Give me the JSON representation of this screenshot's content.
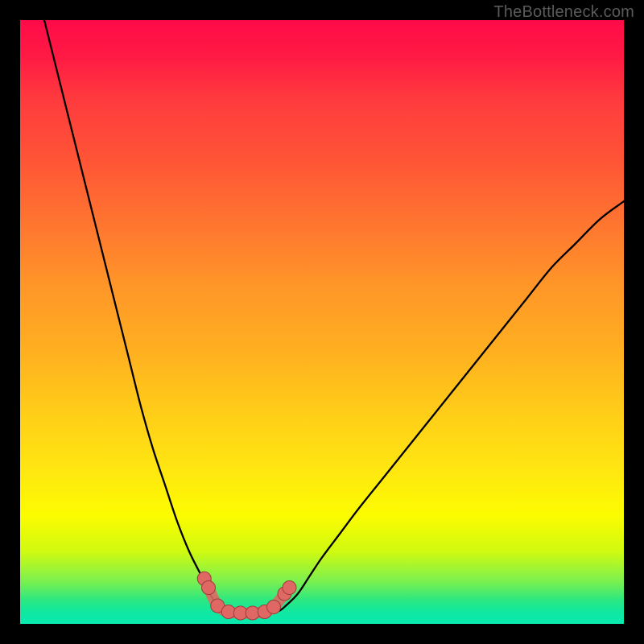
{
  "watermark": "TheBottleneck.com",
  "chart_data": {
    "type": "line",
    "title": "",
    "xlabel": "",
    "ylabel": "",
    "xlim": [
      0,
      100
    ],
    "ylim": [
      0,
      100
    ],
    "series": [
      {
        "name": "left-curve",
        "x": [
          4,
          6,
          8,
          10,
          12,
          14,
          16,
          18,
          20,
          22,
          24,
          26,
          28,
          30,
          31,
          32,
          33,
          34,
          35
        ],
        "y": [
          100,
          92,
          84,
          76,
          68,
          60,
          52,
          44,
          36,
          29,
          23,
          17,
          12,
          8,
          6,
          4,
          3,
          2.2,
          2
        ]
      },
      {
        "name": "right-curve",
        "x": [
          42,
          43,
          44,
          46,
          48,
          50,
          53,
          56,
          60,
          64,
          68,
          72,
          76,
          80,
          84,
          88,
          92,
          96,
          100
        ],
        "y": [
          2,
          2.2,
          3,
          5,
          8,
          11,
          15,
          19,
          24,
          29,
          34,
          39,
          44,
          49,
          54,
          59,
          63,
          67,
          70
        ]
      },
      {
        "name": "markers",
        "points": [
          {
            "x": 30.5,
            "y": 7.5
          },
          {
            "x": 31.2,
            "y": 6.0
          },
          {
            "x": 32.7,
            "y": 3.0
          },
          {
            "x": 34.5,
            "y": 2.0
          },
          {
            "x": 36.5,
            "y": 1.8
          },
          {
            "x": 38.5,
            "y": 1.8
          },
          {
            "x": 40.5,
            "y": 2.0
          },
          {
            "x": 42.0,
            "y": 2.8
          },
          {
            "x": 43.8,
            "y": 5.0
          },
          {
            "x": 44.6,
            "y": 6.0
          }
        ]
      }
    ],
    "colors": {
      "curve": "#000000",
      "marker_fill": "#e06864",
      "marker_stroke": "#9c3d3b"
    }
  }
}
